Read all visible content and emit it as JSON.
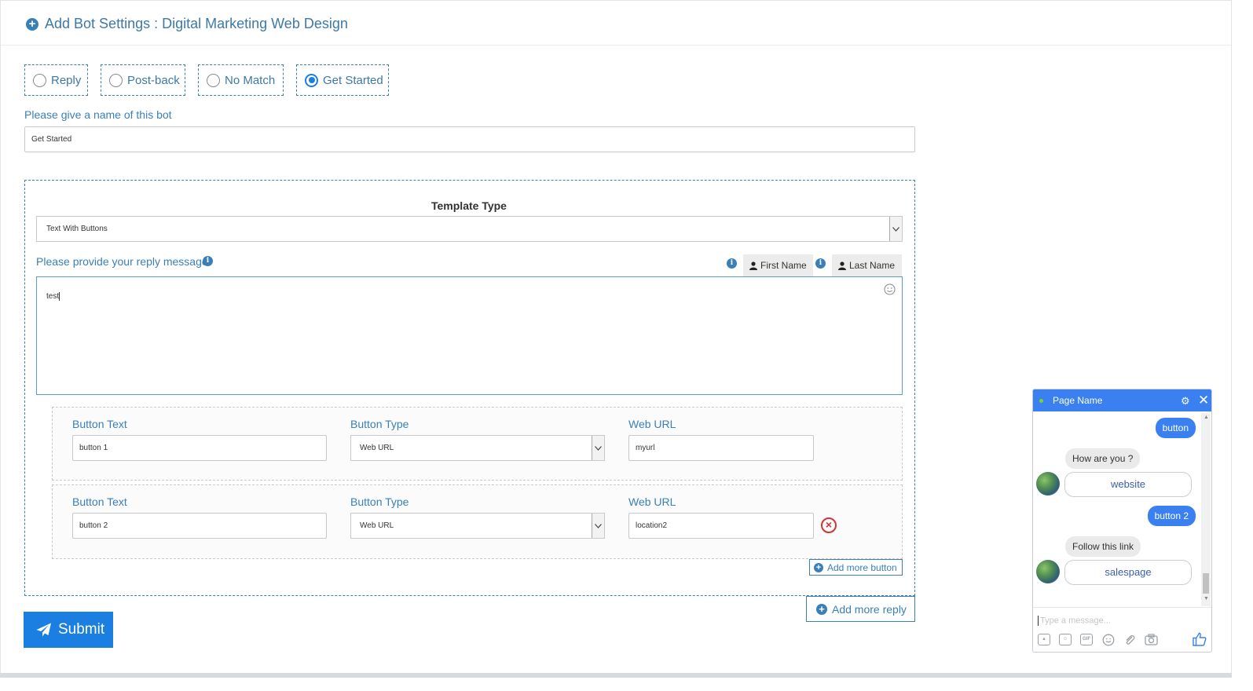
{
  "header": {
    "title": "Add Bot Settings : Digital Marketing Web Design"
  },
  "bot_types": [
    {
      "label": "Reply",
      "checked": false
    },
    {
      "label": "Post-back",
      "checked": false
    },
    {
      "label": "No Match",
      "checked": false
    },
    {
      "label": "Get Started",
      "checked": true
    }
  ],
  "bot_name": {
    "label": "Please give a name of this bot",
    "value": "Get Started"
  },
  "template": {
    "title": "Template Type",
    "selected": "Text With Buttons"
  },
  "reply": {
    "label": "Please provide your reply message",
    "first_name_label": "First Name",
    "last_name_label": "Last Name",
    "message": "test"
  },
  "buttons": [
    {
      "text_label": "Button Text",
      "text_value": "button 1",
      "type_label": "Button Type",
      "type_value": "Web URL",
      "url_label": "Web URL",
      "url_value": "myurl"
    },
    {
      "text_label": "Button Text",
      "text_value": "button 2",
      "type_label": "Button Type",
      "type_value": "Web URL",
      "url_label": "Web URL",
      "url_value": "location2"
    }
  ],
  "actions": {
    "add_more_button": "Add more button",
    "add_more_reply": "Add more reply",
    "submit": "Submit"
  },
  "colors": {
    "accent": "#1a7fe0",
    "label_blue": "#3a7fb8",
    "chat_blue": "#3a80f0",
    "danger": "#d13438"
  },
  "chat": {
    "page_name": "Page Name",
    "messages": {
      "user_1": "button",
      "bot_1": "How are you ?",
      "card_1": "website",
      "user_2": "button 2",
      "bot_2": "Follow this link",
      "card_2": "salespage"
    },
    "input_placeholder": "Type a message...",
    "toolbar_icons": [
      "image-icon",
      "sticker-icon",
      "gif-icon",
      "emoji-icon",
      "attachment-icon",
      "camera-icon",
      "thumbs-up-icon"
    ]
  }
}
